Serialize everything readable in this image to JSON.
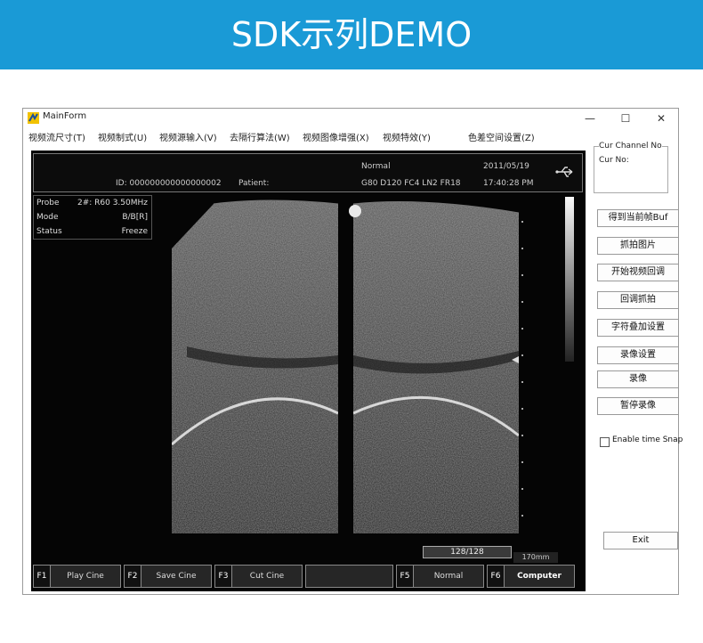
{
  "banner": {
    "title": "SDK示列DEMO"
  },
  "window": {
    "title": "MainForm",
    "controls": {
      "minimize": "—",
      "maximize": "☐",
      "close": "✕"
    }
  },
  "menu": [
    "视频流尺寸(T)",
    "视频制式(U)",
    "视频源输入(V)",
    "去隔行算法(W)",
    "视频图像增强(X)",
    "视频特效(Y)",
    "色差空间设置(Z)"
  ],
  "ultrasound": {
    "id": "ID: 000000000000000002",
    "patient": "Patient:",
    "mode_label": "Normal",
    "params": "G80  D120  FC4  LN2  FR18",
    "date": "2011/05/19",
    "time": "17:40:28 PM",
    "probe": [
      {
        "label": "Probe",
        "value": "2#: R60 3.50MHz"
      },
      {
        "label": "Mode",
        "value": "B/B[R]"
      },
      {
        "label": "Status",
        "value": "Freeze"
      }
    ],
    "frame_counter": "128/128",
    "depth": "170mm",
    "function_keys": [
      {
        "code": "F1",
        "label": "Play Cine"
      },
      {
        "code": "F2",
        "label": "Save Cine"
      },
      {
        "code": "F3",
        "label": "Cut Cine"
      },
      {
        "code": "",
        "label": ""
      },
      {
        "code": "F5",
        "label": "Normal"
      },
      {
        "code": "F6",
        "label": "Computer"
      }
    ]
  },
  "channel": {
    "channel_no": "Cur Channel No",
    "cur_no": "Cur No:"
  },
  "buttons": [
    "得到当前帧Buf",
    "抓拍图片",
    "开始视频回调",
    "回调抓拍",
    "字符叠加设置",
    "录像设置",
    "录像",
    "暂停录像"
  ],
  "enable_snap": "Enable time Snap",
  "exit": "Exit"
}
